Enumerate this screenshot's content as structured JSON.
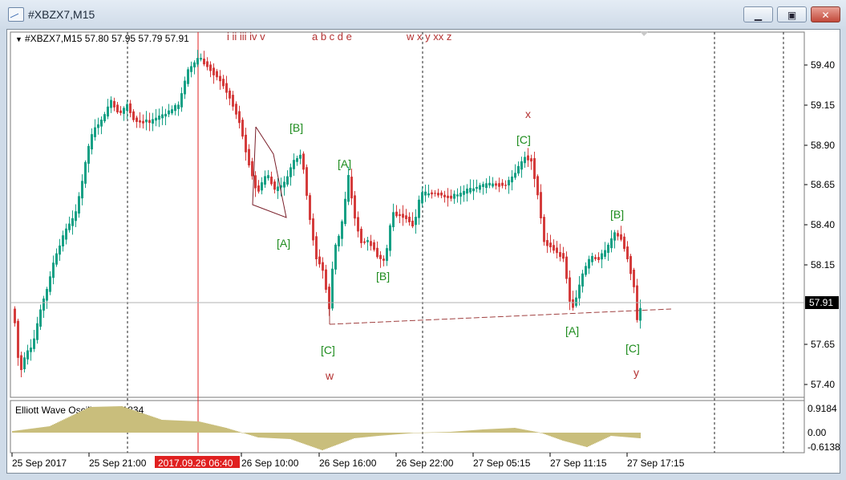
{
  "window": {
    "title": "#XBZX7,M15",
    "minimize_label": "▁",
    "maximize_label": "▣",
    "close_label": "✕",
    "icon": "chart-window-icon"
  },
  "chart": {
    "info_line": "#XBZX7,M15  57.80 57.95 57.79 57.91",
    "current_price": "57.91",
    "price_labels": [
      "59.40",
      "59.15",
      "58.90",
      "58.65",
      "58.40",
      "58.15",
      "57.90",
      "57.65",
      "57.40"
    ],
    "time_labels": [
      "25 Sep 2017",
      "25 Sep 21:00",
      "26 Sep 10:00",
      "26 Sep 16:00",
      "26 Sep 22:00",
      "27 Sep 05:15",
      "27 Sep 11:15",
      "27 Sep 17:15"
    ],
    "time_highlight": "2017.09.26 06:40",
    "wave_legend_1": "i ii iii iv v",
    "wave_legend_2": "a b c d e",
    "wave_legend_3": "w x y xx z",
    "wave_labels": {
      "b1": "[B]",
      "a1": "[A]",
      "a2": "[A]",
      "b2": "[B]",
      "c1": "[C]",
      "w": "w",
      "x": "x",
      "c2": "[C]",
      "b3": "[B]",
      "a3": "[A]",
      "c3": "[C]",
      "y": "y"
    },
    "oscillator": {
      "title": "Elliott Wave Oscillator -0.1834",
      "levels": [
        "0.9184",
        "0.00",
        "-0.6138"
      ]
    },
    "colors": {
      "bull": "#16a085",
      "bear": "#d43c3c",
      "wave_green": "#1e8c1e",
      "wave_red": "#b33030",
      "oscillator": "#c9be7c",
      "vline_red": "#e02020"
    }
  }
}
